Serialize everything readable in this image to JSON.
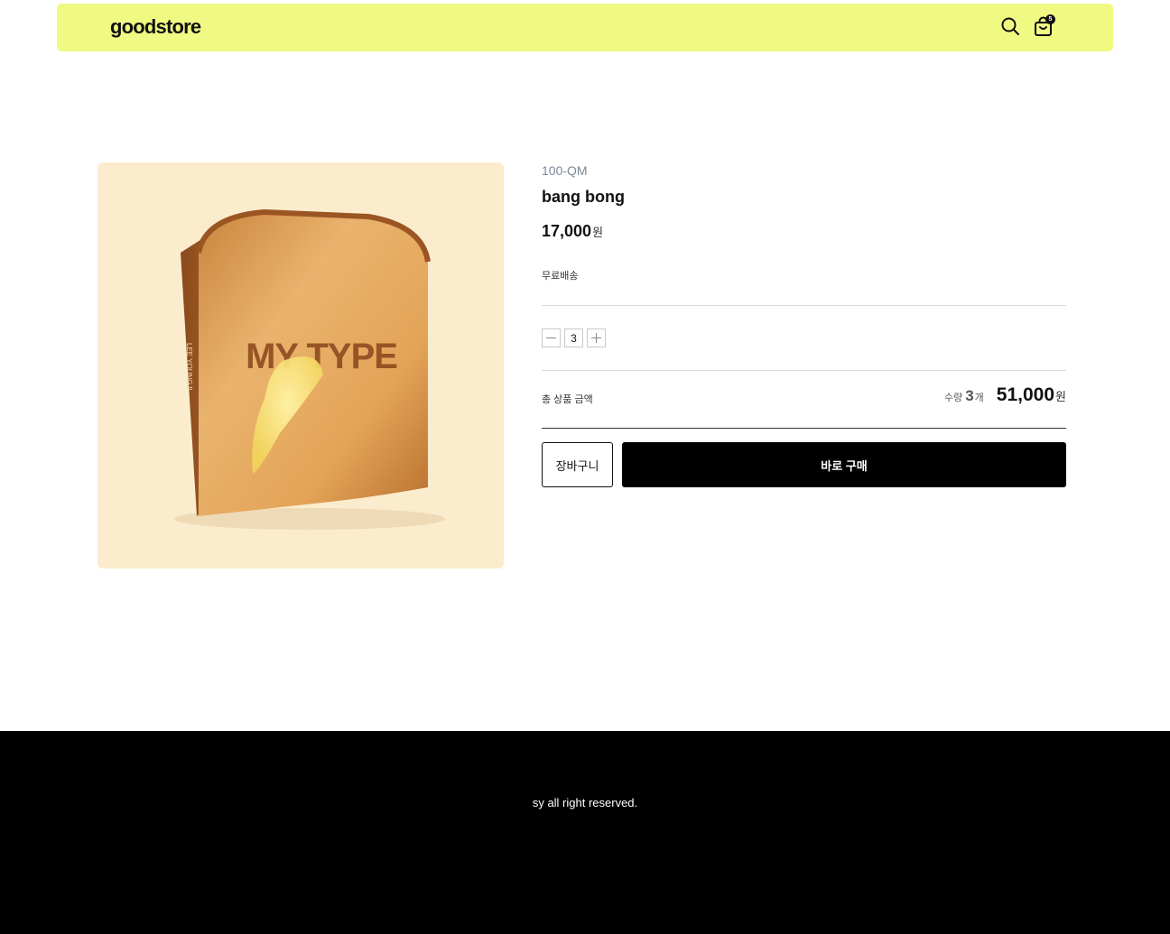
{
  "header": {
    "logo": "goodstore",
    "background": "#f0fa82",
    "search_icon": "search-icon",
    "cart_icon": "shopping-bag-icon",
    "cart_count": "5"
  },
  "product": {
    "image_text": "MY TYPE",
    "image_side_text": "LEE YOUNGJI",
    "image_background": "#fbecce",
    "code": "100-QM",
    "name": "bang bong",
    "price": "17,000",
    "price_unit": "원",
    "shipping": "무료배송"
  },
  "quantity": {
    "value": "3",
    "minus_icon": "minus-icon",
    "plus_icon": "plus-icon"
  },
  "total": {
    "label": "총 상품 금액",
    "qty_label": "수량",
    "qty_value": "3",
    "qty_unit": "개",
    "price": "51,000",
    "price_unit": "원"
  },
  "actions": {
    "cart_label": "장바구니",
    "buy_label": "바로 구매"
  },
  "footer": {
    "copyright": "sy all right reserved."
  }
}
